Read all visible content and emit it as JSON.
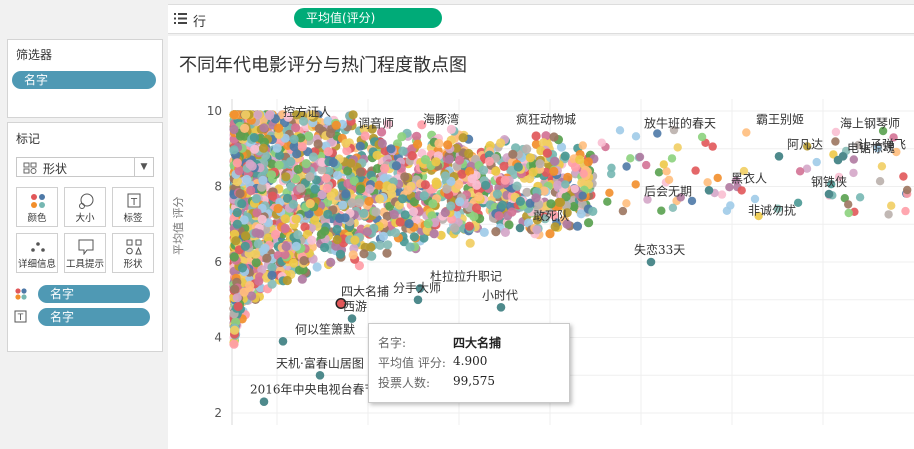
{
  "shelf": {
    "label": "行",
    "pill": "平均值(评分)"
  },
  "filters": {
    "title": "筛选器",
    "pill": "名字"
  },
  "marks": {
    "title": "标记",
    "type": "形状",
    "buttons": [
      {
        "label": "颜色",
        "icon": "color-dots-icon"
      },
      {
        "label": "大小",
        "icon": "size-icon"
      },
      {
        "label": "标签",
        "icon": "label-icon"
      },
      {
        "label": "详细信息",
        "icon": "detail-icon"
      },
      {
        "label": "工具提示",
        "icon": "tooltip-icon"
      },
      {
        "label": "形状",
        "icon": "shape-icon"
      }
    ],
    "fields": [
      {
        "label": "名字",
        "icon": "color-dots-icon"
      },
      {
        "label": "名字",
        "icon": "text-label-icon"
      }
    ]
  },
  "tooltip": {
    "name_key": "名字:",
    "name_val": "四大名捕",
    "score_key": "平均值 评分:",
    "score_val": "4.900",
    "votes_key": "投票人数:",
    "votes_val": "99,575"
  },
  "chart_data": {
    "type": "scatter",
    "title": "不同年代电影评分与热门程度散点图",
    "ylabel": "平均值 评分",
    "xlabel": "",
    "ylim": [
      2,
      10
    ],
    "yticks": [
      2,
      4,
      6,
      8,
      10
    ],
    "grid": true,
    "labeled_points": [
      {
        "label": "控方证人",
        "y": 9.6
      },
      {
        "label": "调音师",
        "y": 9.3
      },
      {
        "label": "海豚湾",
        "y": 9.4
      },
      {
        "label": "疯狂动物城",
        "y": 9.4
      },
      {
        "label": "放牛班的春天",
        "y": 9.3
      },
      {
        "label": "霸王别姬",
        "y": 9.4
      },
      {
        "label": "海上钢琴师",
        "y": 9.3
      },
      {
        "label": "阿凡达",
        "y": 8.8
      },
      {
        "label": "让子弹飞",
        "y": 8.8
      },
      {
        "label": "电锯惊魂",
        "y": 8.7
      },
      {
        "label": "黑衣人",
        "y": 7.9
      },
      {
        "label": "钢铁侠",
        "y": 7.8
      },
      {
        "label": "后会无期",
        "y": 7.5
      },
      {
        "label": "非诚勿扰",
        "y": 7.0
      },
      {
        "label": "敢死队",
        "y": 6.9
      },
      {
        "label": "失恋33天",
        "y": 6.0
      },
      {
        "label": "杜拉拉升职记",
        "y": 5.3
      },
      {
        "label": "分手大师",
        "y": 5.0
      },
      {
        "label": "小时代",
        "y": 4.8
      },
      {
        "label": "四大名捕",
        "y": 4.9
      },
      {
        "label": "西游",
        "y": 4.5
      },
      {
        "label": "何以笙箫默",
        "y": 3.9
      },
      {
        "label": "天机·富春山居图",
        "y": 3.0
      },
      {
        "label": "2016年中央电视台春节",
        "y": 2.3
      }
    ]
  }
}
